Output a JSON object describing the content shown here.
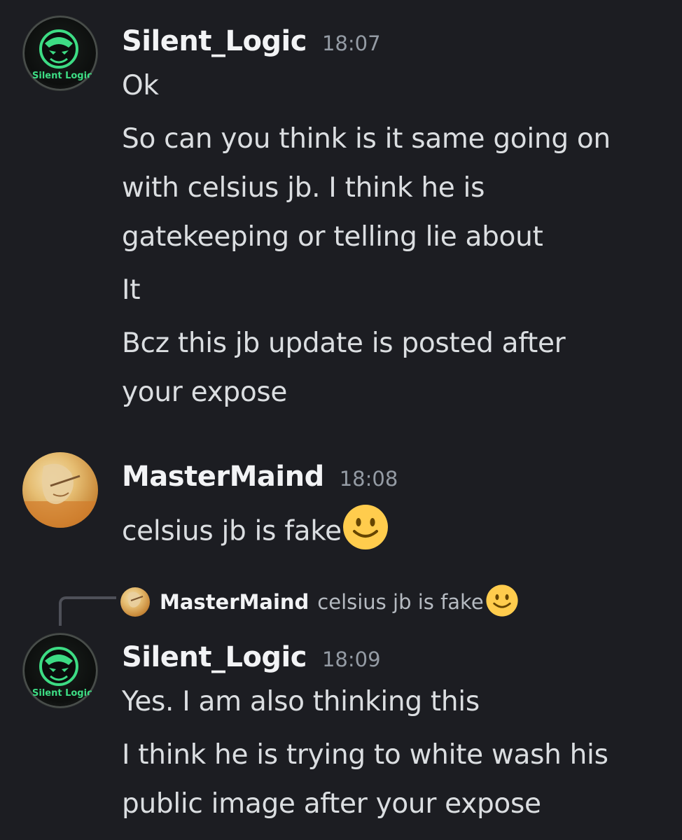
{
  "messages": [
    {
      "author": "Silent_Logic",
      "time": "18:07",
      "avatar_text": "Silent Logic",
      "lines": [
        "Ok",
        "So can you think is it same going on",
        "with celsius jb. I think he is",
        "gatekeeping or telling lie about",
        "It",
        "Bcz this jb update is posted after",
        "your expose"
      ]
    },
    {
      "author": "MasterMaind",
      "time": "18:08",
      "lines": [
        "celsius jb is fake"
      ],
      "emoji": "slightly-smiling-face"
    },
    {
      "author": "Silent_Logic",
      "time": "18:09",
      "avatar_text": "Silent Logic",
      "reply": {
        "author": "MasterMaind",
        "text": "celsius jb is fake",
        "emoji": "slightly-smiling-face"
      },
      "lines": [
        "Yes. I am also thinking this",
        "I think he is trying to white wash his",
        "public image after your expose"
      ]
    }
  ],
  "colors": {
    "background": "#1c1d22",
    "username": "#f2f3f5",
    "timestamp": "#949ba4",
    "text": "#dbdee1",
    "logo_green": "#3ddc84"
  }
}
